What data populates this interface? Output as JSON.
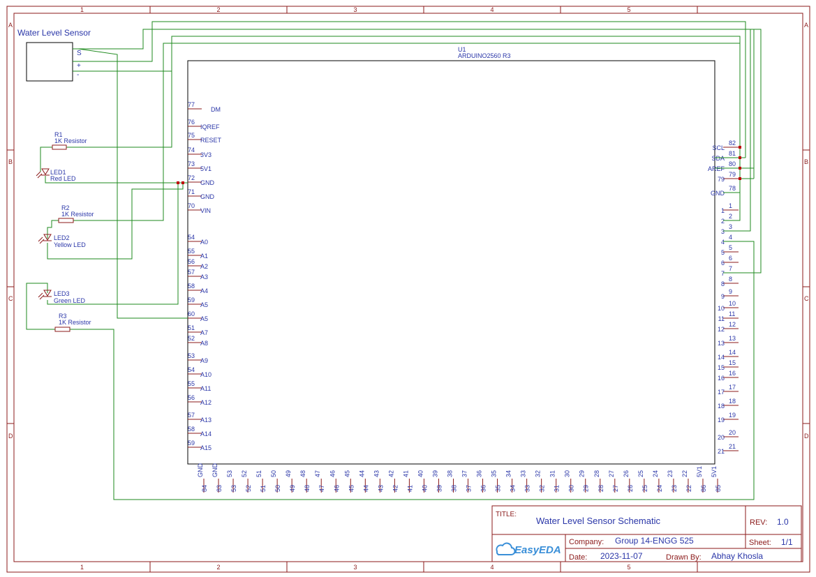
{
  "frame": {
    "columns": [
      "1",
      "2",
      "3",
      "4",
      "5"
    ],
    "rows": [
      "A",
      "B",
      "C",
      "D"
    ]
  },
  "sensor": {
    "title": "Water Level Sensor",
    "pins": [
      "S",
      "+",
      "-"
    ]
  },
  "mcu": {
    "designator": "U1",
    "part": "ARDUINO2560 R3",
    "left_pins": [
      {
        "num": "77",
        "name": "DM"
      },
      {
        "num": "76",
        "name": "IQREF"
      },
      {
        "num": "75",
        "name": "RESET"
      },
      {
        "num": "74",
        "name": "3V3"
      },
      {
        "num": "73",
        "name": "5V1"
      },
      {
        "num": "72",
        "name": "GND"
      },
      {
        "num": "71",
        "name": "GND"
      },
      {
        "num": "70",
        "name": "VIN"
      },
      {
        "num": "54",
        "name": "A0"
      },
      {
        "num": "55",
        "name": "A1"
      },
      {
        "num": "56",
        "name": "A2"
      },
      {
        "num": "57",
        "name": "A3"
      },
      {
        "num": "58",
        "name": "A4"
      },
      {
        "num": "59",
        "name": "A5"
      },
      {
        "num": "60",
        "name": "A5"
      },
      {
        "num": "51",
        "name": "A7"
      },
      {
        "num": "52",
        "name": "A8"
      },
      {
        "num": "53",
        "name": "A9"
      },
      {
        "num": "54",
        "name": "A10"
      },
      {
        "num": "55",
        "name": "A11"
      },
      {
        "num": "56",
        "name": "A12"
      },
      {
        "num": "57",
        "name": "A13"
      },
      {
        "num": "58",
        "name": "A14"
      },
      {
        "num": "59",
        "name": "A15"
      }
    ],
    "right_pins": [
      {
        "num": "82",
        "name": "SCL"
      },
      {
        "num": "81",
        "name": "SDA"
      },
      {
        "num": "80",
        "name": "AREF"
      },
      {
        "num": "79",
        "name": "79"
      },
      {
        "num": "78",
        "name": "GND"
      },
      {
        "num": "1",
        "name": "1"
      },
      {
        "num": "2",
        "name": "2"
      },
      {
        "num": "3",
        "name": "3"
      },
      {
        "num": "4",
        "name": "4"
      },
      {
        "num": "5",
        "name": "5"
      },
      {
        "num": "6",
        "name": "6"
      },
      {
        "num": "7",
        "name": "7"
      },
      {
        "num": "8",
        "name": "8"
      },
      {
        "num": "9",
        "name": "9"
      },
      {
        "num": "10",
        "name": "10"
      },
      {
        "num": "11",
        "name": "11"
      },
      {
        "num": "12",
        "name": "12"
      },
      {
        "num": "13",
        "name": "13"
      },
      {
        "num": "14",
        "name": "14"
      },
      {
        "num": "15",
        "name": "15"
      },
      {
        "num": "16",
        "name": "16"
      },
      {
        "num": "17",
        "name": "17"
      },
      {
        "num": "18",
        "name": "18"
      },
      {
        "num": "19",
        "name": "19"
      },
      {
        "num": "20",
        "name": "20"
      },
      {
        "num": "21",
        "name": "21"
      }
    ],
    "bottom_pins": [
      {
        "num": "84",
        "name": "GND"
      },
      {
        "num": "83",
        "name": "GND"
      },
      {
        "num": "53",
        "name": "53"
      },
      {
        "num": "52",
        "name": "52"
      },
      {
        "num": "51",
        "name": "51"
      },
      {
        "num": "50",
        "name": "50"
      },
      {
        "num": "49",
        "name": "49"
      },
      {
        "num": "48",
        "name": "48"
      },
      {
        "num": "47",
        "name": "47"
      },
      {
        "num": "46",
        "name": "46"
      },
      {
        "num": "45",
        "name": "45"
      },
      {
        "num": "44",
        "name": "44"
      },
      {
        "num": "43",
        "name": "43"
      },
      {
        "num": "42",
        "name": "42"
      },
      {
        "num": "41",
        "name": "41"
      },
      {
        "num": "40",
        "name": "40"
      },
      {
        "num": "39",
        "name": "39"
      },
      {
        "num": "38",
        "name": "38"
      },
      {
        "num": "37",
        "name": "37"
      },
      {
        "num": "36",
        "name": "36"
      },
      {
        "num": "35",
        "name": "35"
      },
      {
        "num": "34",
        "name": "34"
      },
      {
        "num": "33",
        "name": "33"
      },
      {
        "num": "32",
        "name": "32"
      },
      {
        "num": "31",
        "name": "31"
      },
      {
        "num": "30",
        "name": "30"
      },
      {
        "num": "29",
        "name": "29"
      },
      {
        "num": "28",
        "name": "28"
      },
      {
        "num": "27",
        "name": "27"
      },
      {
        "num": "26",
        "name": "26"
      },
      {
        "num": "25",
        "name": "25"
      },
      {
        "num": "24",
        "name": "24"
      },
      {
        "num": "23",
        "name": "23"
      },
      {
        "num": "22",
        "name": "22"
      },
      {
        "num": "86",
        "name": "5V1"
      },
      {
        "num": "85",
        "name": "5V1"
      }
    ]
  },
  "parts": {
    "r1": {
      "ref": "R1",
      "value": "1K Resistor"
    },
    "r2": {
      "ref": "R2",
      "value": "1K Resistor"
    },
    "r3": {
      "ref": "R3",
      "value": "1K Resistor"
    },
    "led1": {
      "ref": "LED1",
      "value": "Red LED"
    },
    "led2": {
      "ref": "LED2",
      "value": "Yellow LED"
    },
    "led3": {
      "ref": "LED3",
      "value": "Green LED"
    }
  },
  "title_block": {
    "title_label": "TITLE:",
    "title": "Water Level Sensor Schematic",
    "rev_label": "REV:",
    "rev": "1.0",
    "company_label": "Company:",
    "company": "Group 14-ENGG 525",
    "sheet_label": "Sheet:",
    "sheet": "1/1",
    "date_label": "Date:",
    "date": "2023-11-07",
    "drawn_label": "Drawn By:",
    "drawn_by": "Abhay Khosla",
    "logo_text": "EasyEDA"
  },
  "colors": {
    "frame": "#8b1a1a",
    "wire": "#1e8a1e",
    "text": "#2a36a8",
    "junction": "#c00000"
  }
}
